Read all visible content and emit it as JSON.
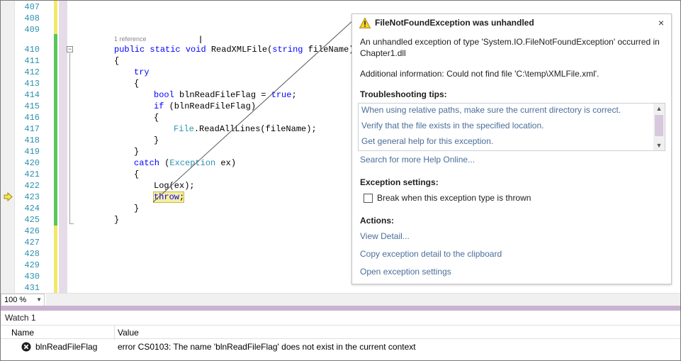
{
  "editor": {
    "line_numbers": [
      "407",
      "408",
      "409",
      "410",
      "411",
      "412",
      "413",
      "414",
      "415",
      "416",
      "417",
      "418",
      "419",
      "420",
      "421",
      "422",
      "423",
      "424",
      "425",
      "426",
      "427",
      "428",
      "429",
      "430",
      "431"
    ],
    "codelens": "1 reference",
    "code": {
      "l410": {
        "kw1": "public",
        "kw2": "static",
        "kw3": "void",
        "name": "ReadXMLFile(",
        "kw4": "string",
        "param": " fileName)"
      },
      "l411": "{",
      "l412": "try",
      "l413": "{",
      "l414": {
        "kw": "bool",
        "rest": " blnReadFileFlag = ",
        "kw2": "true",
        "end": ";"
      },
      "l415": {
        "kw": "if",
        "rest": " (blnReadFileFlag)"
      },
      "l416": "{",
      "l417": {
        "type": "File",
        "rest": ".ReadAllLines(fileName);"
      },
      "l418": "}",
      "l419": "}",
      "l420": {
        "kw": "catch",
        "open": " (",
        "type": "Exception",
        "rest": " ex)"
      },
      "l421": "{",
      "l422": "Log(ex);",
      "l423": {
        "kw": "throw",
        "end": ";"
      },
      "l424": "}",
      "l425": "}"
    }
  },
  "popup": {
    "title": "FileNotFoundException was unhandled",
    "close_label": "×",
    "message_line1": "An unhandled exception of type 'System.IO.FileNotFoundException' occurred in",
    "message_line2": "Chapter1.dll",
    "additional_info": "Additional information: Could not find file 'C:\\temp\\XMLFile.xml'.",
    "tips_heading": "Troubleshooting tips:",
    "tips": [
      "When using relative paths, make sure the current directory is correct.",
      "Verify that the file exists in the specified location.",
      "Get general help for this exception."
    ],
    "search_help": "Search for more Help Online...",
    "settings_heading": "Exception settings:",
    "break_checkbox_label": "Break when this exception type is thrown",
    "break_checked": false,
    "actions_heading": "Actions:",
    "actions": [
      "View Detail...",
      "Copy exception detail to the clipboard",
      "Open exception settings"
    ]
  },
  "zoom": {
    "value": "100 %"
  },
  "watch": {
    "title": "Watch 1",
    "col_name": "Name",
    "col_value": "Value",
    "rows": [
      {
        "name": "blnReadFileFlag",
        "value": "error CS0103: The name 'blnReadFileFlag' does not exist in the current context"
      }
    ]
  },
  "colors": {
    "line_number": "#2b91af",
    "keyword": "#0000ff",
    "type": "#2b91af",
    "link": "#4a6e9a",
    "splitter": "#c9b3d0",
    "change_saved": "#57c758",
    "change_unsaved": "#f2e868"
  }
}
